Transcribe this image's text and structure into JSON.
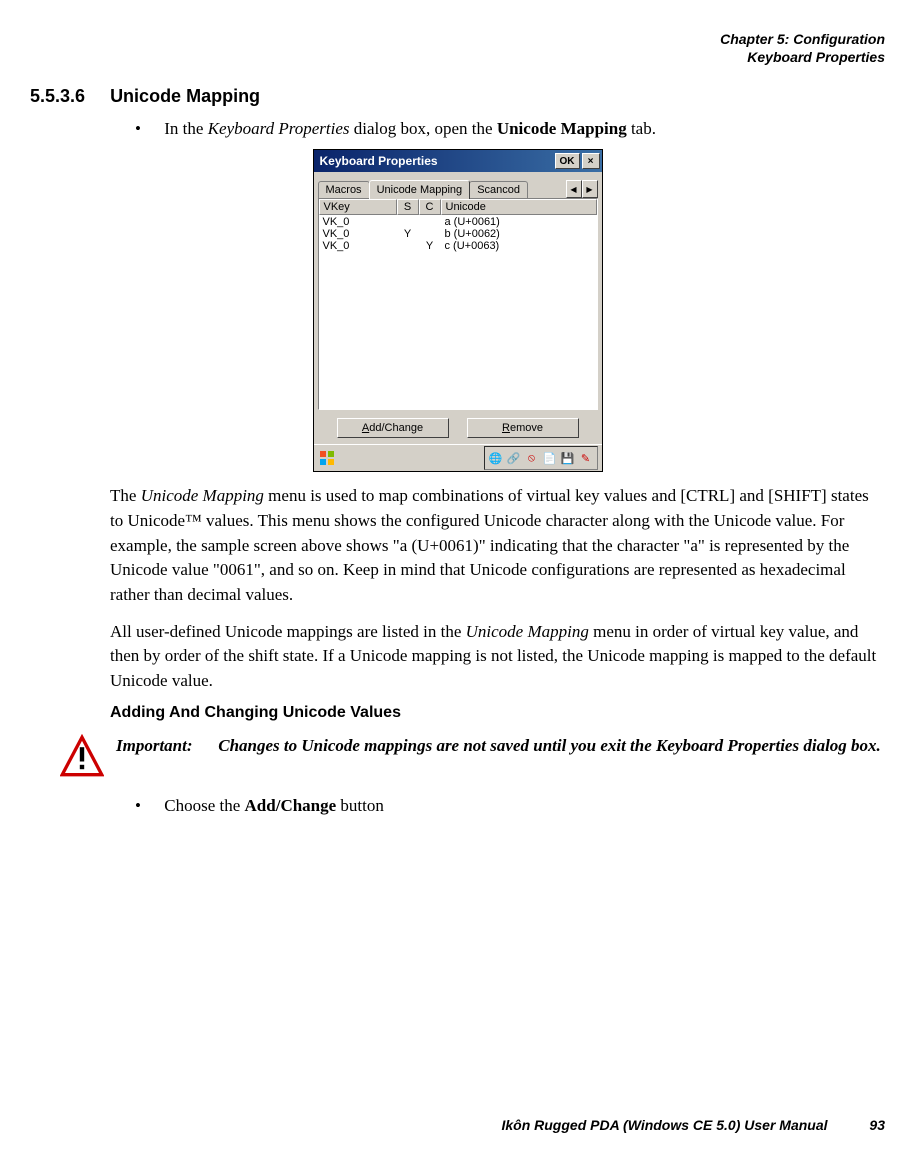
{
  "header": {
    "chapter": "Chapter 5: Configuration",
    "section": "Keyboard Properties"
  },
  "section": {
    "number": "5.5.3.6",
    "title": "Unicode Mapping"
  },
  "bullet1_prefix": "In the ",
  "bullet1_italic": "Keyboard Properties",
  "bullet1_mid": " dialog box, open the ",
  "bullet1_bold": "Unicode Mapping",
  "bullet1_suffix": " tab.",
  "dialog": {
    "title": "Keyboard Properties",
    "ok": "OK",
    "close": "×",
    "tabs": {
      "macros": "Macros",
      "unicode": "Unicode Mapping",
      "scancode": "Scancod",
      "left_arrow": "◀",
      "right_arrow": "▶"
    },
    "listHeader": {
      "vkey": "VKey",
      "s": "S",
      "c": "C",
      "unicode": "Unicode"
    },
    "rows": [
      {
        "vkey": "VK_0",
        "s": "",
        "c": "",
        "unicode": "a (U+0061)"
      },
      {
        "vkey": "VK_0",
        "s": "Y",
        "c": "",
        "unicode": "b (U+0062)"
      },
      {
        "vkey": "VK_0",
        "s": "",
        "c": "Y",
        "unicode": "c (U+0063)"
      }
    ],
    "buttons": {
      "add": "Add/Change",
      "remove": "Remove",
      "add_u": "A",
      "remove_u": "R"
    }
  },
  "para1_a": "The ",
  "para1_i1": "Unicode Mapping",
  "para1_b": " menu is used to map combinations of virtual key values and [CTRL] and [SHIFT] states to Unicode™ values. This menu shows the configured Unicode character along with the Unicode value. For example, the sample screen above shows \"a (U+0061)\" indicating that the character \"a\" is represented by the Unicode value \"0061\", and so on. Keep in mind that Unicode configurations are represented as hexadecimal rather than decimal values.",
  "para2_a": "All user-defined Unicode mappings are listed in the ",
  "para2_i1": "Unicode Mapping",
  "para2_b": " menu in order of virtual key value, and then by order of the shift state. If a Unicode mapping is not listed, the Unicode mapping is mapped to the default Unicode value.",
  "subheading": "Adding And Changing Unicode Values",
  "important": {
    "label": "Important:",
    "text": "Changes to Unicode mappings are not saved until you exit the Keyboard Properties dialog box."
  },
  "bullet2_prefix": "Choose the ",
  "bullet2_bold": "Add/Change",
  "bullet2_suffix": " button",
  "footer": {
    "manual": "Ikôn Rugged PDA (Windows CE 5.0) User Manual",
    "page": "93"
  }
}
